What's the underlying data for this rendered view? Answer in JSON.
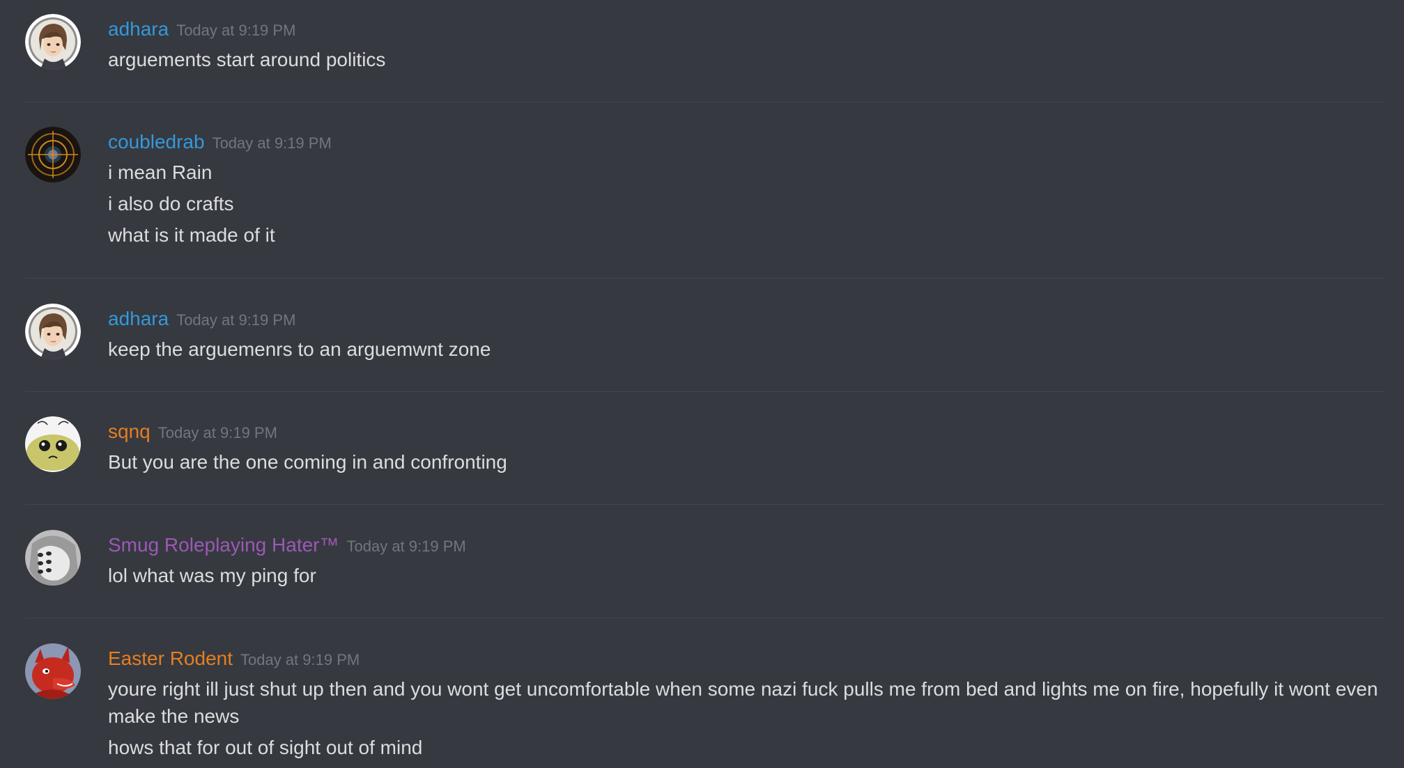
{
  "colors": {
    "background": "#36393f",
    "divider": "#42454b",
    "text": "#dcddde",
    "timestamp": "#72767d",
    "blue_user": "#3498db",
    "orange_user": "#e67e22",
    "purple_user": "#9b59b6"
  },
  "messages": [
    {
      "username": "adhara",
      "timestamp": "Today at 9:19 PM",
      "avatar_icon": "anime-girl-avatar-icon",
      "lines": [
        "arguements start around politics"
      ]
    },
    {
      "username": "coubledrab",
      "timestamp": "Today at 9:19 PM",
      "avatar_icon": "glowing-eye-avatar-icon",
      "lines": [
        "i mean Rain",
        "i also do crafts",
        "what is it made of it"
      ]
    },
    {
      "username": "adhara",
      "timestamp": "Today at 9:19 PM",
      "avatar_icon": "anime-girl-avatar-icon",
      "lines": [
        "keep the arguemenrs to an arguemwnt zone"
      ]
    },
    {
      "username": "sqnq",
      "timestamp": "Today at 9:19 PM",
      "avatar_icon": "cartoon-bug-avatar-icon",
      "lines": [
        "But you are the one coming in and confronting"
      ]
    },
    {
      "username": "Smug Roleplaying Hater™",
      "timestamp": "Today at 9:19 PM",
      "avatar_icon": "many-eyes-avatar-icon",
      "lines": [
        "lol what was my ping for"
      ]
    },
    {
      "username": "Easter Rodent",
      "timestamp": "Today at 9:19 PM",
      "avatar_icon": "red-dragon-avatar-icon",
      "lines": [
        "youre right ill just shut up then and you wont get uncomfortable when some nazi fuck pulls me from bed and lights me on fire, hopefully it wont even make the news",
        "hows that for out of sight out of mind"
      ]
    }
  ]
}
